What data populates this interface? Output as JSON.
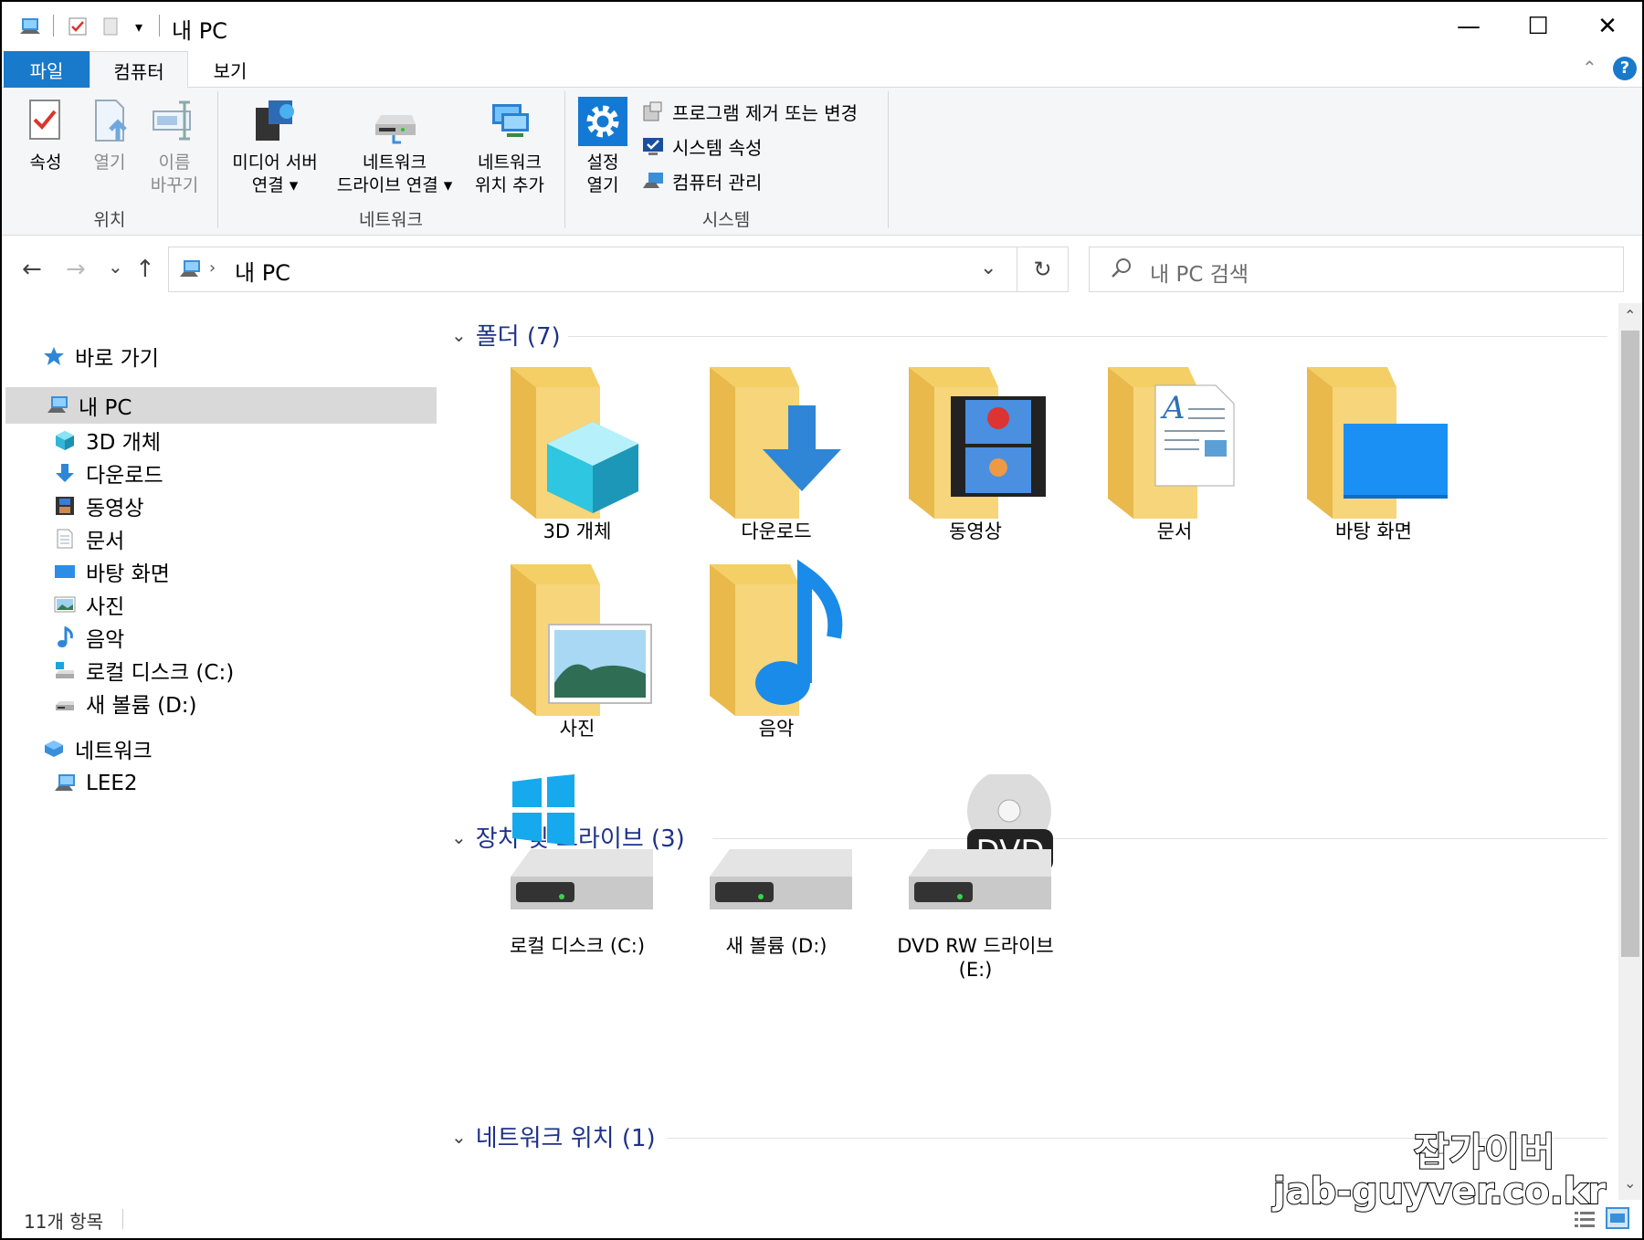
{
  "window": {
    "title": "내 PC",
    "minimize": "—",
    "maximize": "☐",
    "close": "✕"
  },
  "tabs": {
    "file": "파일",
    "computer": "컴퓨터",
    "view": "보기"
  },
  "ribbon": {
    "location": {
      "label": "위치",
      "properties": "속성",
      "open": "열기",
      "rename": [
        "이름",
        "바꾸기"
      ]
    },
    "network": {
      "label": "네트워크",
      "media_server": [
        "미디어 서버",
        "연결 ▾"
      ],
      "map_drive": [
        "네트워크",
        "드라이브 연결 ▾"
      ],
      "add_location": [
        "네트워크",
        "위치 추가"
      ]
    },
    "system": {
      "label": "시스템",
      "open_settings": [
        "설정",
        "열기"
      ],
      "uninstall": "프로그램 제거 또는 변경",
      "sys_props": "시스템 속성",
      "manage": "컴퓨터 관리"
    }
  },
  "nav": {
    "back": "←",
    "forward": "→",
    "recent": "⌄",
    "up": "↑",
    "path": "내 PC",
    "dropdown": "⌄",
    "refresh": "↻",
    "search_placeholder": "내 PC 검색"
  },
  "sidebar": [
    {
      "label": "바로 가기",
      "icon": "star-icon"
    },
    {
      "label": "내 PC",
      "icon": "pc-icon",
      "selected": true
    },
    {
      "label": "3D 개체",
      "icon": "cube-icon"
    },
    {
      "label": "다운로드",
      "icon": "download-icon"
    },
    {
      "label": "동영상",
      "icon": "film-icon"
    },
    {
      "label": "문서",
      "icon": "document-icon"
    },
    {
      "label": "바탕 화면",
      "icon": "desktop-icon"
    },
    {
      "label": "사진",
      "icon": "picture-icon"
    },
    {
      "label": "음악",
      "icon": "music-icon"
    },
    {
      "label": "로컬 디스크 (C:)",
      "icon": "drive-c-icon"
    },
    {
      "label": "새 볼륨 (D:)",
      "icon": "drive-icon"
    },
    {
      "label": "네트워크",
      "icon": "network-icon"
    },
    {
      "label": "LEE2",
      "icon": "computer-icon"
    }
  ],
  "groups": {
    "folders": {
      "title": "폴더 (7)",
      "items": [
        "3D 개체",
        "다운로드",
        "동영상",
        "문서",
        "바탕 화면",
        "사진",
        "음악"
      ]
    },
    "drives": {
      "title": "장치 및 드라이브 (3)",
      "items": [
        "로컬 디스크 (C:)",
        "새 볼륨 (D:)",
        "DVD RW 드라이브\n(E:)"
      ],
      "dvd_badge": "DVD"
    },
    "network": {
      "title": "네트워크 위치 (1)"
    }
  },
  "status": {
    "count": "11개 항목"
  },
  "watermark": {
    "line1": "잡가이버",
    "line2": "jab-guyver.co.kr"
  },
  "colors": {
    "accent": "#1979ca",
    "folder": "#f3cf66",
    "selection": "#d9d9d9",
    "group_title": "#1e3287"
  }
}
